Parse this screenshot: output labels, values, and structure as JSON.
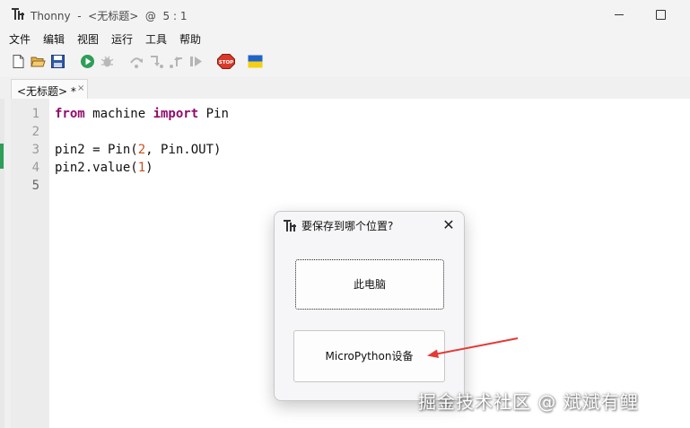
{
  "window": {
    "title": "Thonny  -  <无标题>  @  5 : 1"
  },
  "menu": [
    "文件",
    "编辑",
    "视图",
    "运行",
    "工具",
    "帮助"
  ],
  "toolbar": {
    "icons": [
      "new-file-icon",
      "open-folder-icon",
      "save-icon",
      "run-icon",
      "debug-icon",
      "step-over-icon",
      "step-into-icon",
      "step-out-icon",
      "resume-icon",
      "stop-icon",
      "ukraine-flag-icon"
    ],
    "stop_label": "STOP"
  },
  "tab": {
    "label": "<无标题>  *",
    "close": "×"
  },
  "editor": {
    "line_numbers": [
      "1",
      "2",
      "3",
      "4",
      "5"
    ],
    "lines": [
      [
        {
          "t": "from",
          "k": "kw"
        },
        {
          "t": " machine ",
          "k": ""
        },
        {
          "t": "import",
          "k": "kw"
        },
        {
          "t": " Pin",
          "k": ""
        }
      ],
      [],
      [
        {
          "t": "pin2 = Pin(",
          "k": ""
        },
        {
          "t": "2",
          "k": "num"
        },
        {
          "t": ", Pin.OUT)",
          "k": ""
        }
      ],
      [
        {
          "t": "pin2.value(",
          "k": ""
        },
        {
          "t": "1",
          "k": "num"
        },
        {
          "t": ")",
          "k": ""
        }
      ],
      []
    ],
    "current_line": 5
  },
  "dialog": {
    "title": "要保存到哪个位置?",
    "close": "✕",
    "options": [
      "此电脑",
      "MicroPython设备"
    ]
  },
  "colors": {
    "keyword": "#8f0c6b",
    "number": "#c8511a",
    "run": "#2e9e58",
    "stop": "#d93a2b",
    "annotation_arrow": "#e53935"
  },
  "watermark": "掘金技术社区 @ 斌斌有鲤"
}
